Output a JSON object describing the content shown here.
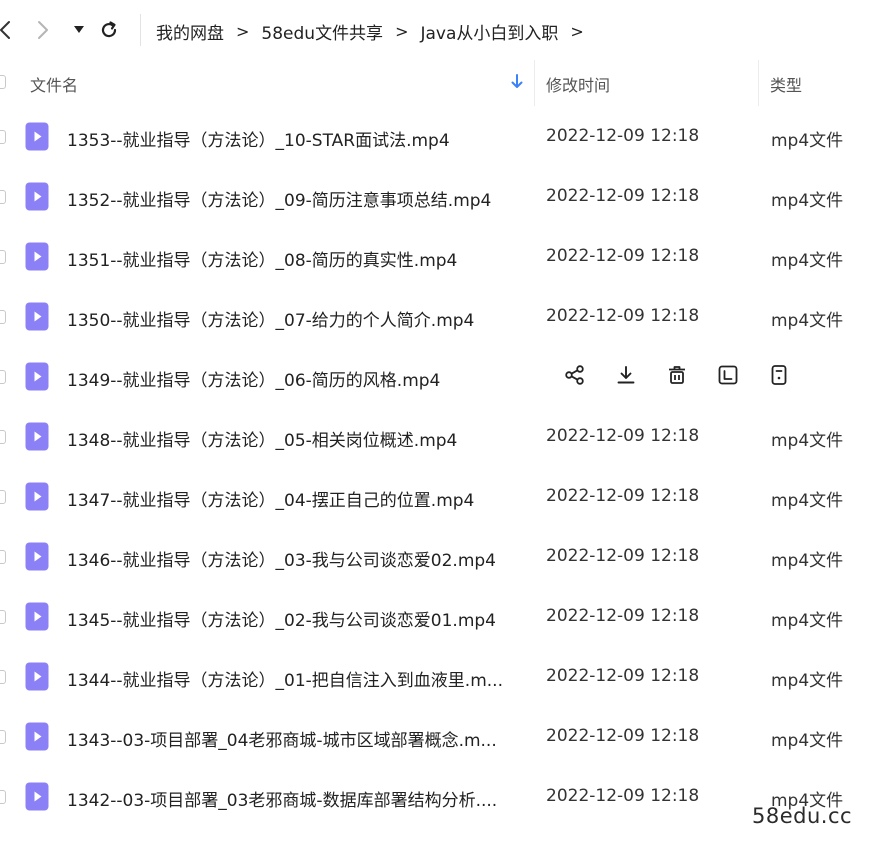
{
  "nav": {
    "breadcrumb": [
      "我的网盘",
      "58edu文件共享",
      "Java从小白到入职"
    ],
    "separator": ">"
  },
  "columns": {
    "name": "文件名",
    "modified": "修改时间",
    "type": "类型"
  },
  "colors": {
    "file_icon": "#8b80f5",
    "sort_arrow": "#3b82f6"
  },
  "files": [
    {
      "name": "1353--就业指导（方法论）_10-STAR面试法.mp4",
      "modified": "2022-12-09 12:18",
      "type": "mp4文件"
    },
    {
      "name": "1352--就业指导（方法论）_09-简历注意事项总结.mp4",
      "modified": "2022-12-09 12:18",
      "type": "mp4文件"
    },
    {
      "name": "1351--就业指导（方法论）_08-简历的真实性.mp4",
      "modified": "2022-12-09 12:18",
      "type": "mp4文件"
    },
    {
      "name": "1350--就业指导（方法论）_07-给力的个人简介.mp4",
      "modified": "2022-12-09 12:18",
      "type": "mp4文件"
    },
    {
      "name": "1349--就业指导（方法论）_06-简历的风格.mp4",
      "modified": "",
      "type": "",
      "hovered": true
    },
    {
      "name": "1348--就业指导（方法论）_05-相关岗位概述.mp4",
      "modified": "2022-12-09 12:18",
      "type": "mp4文件"
    },
    {
      "name": "1347--就业指导（方法论）_04-摆正自己的位置.mp4",
      "modified": "2022-12-09 12:18",
      "type": "mp4文件"
    },
    {
      "name": "1346--就业指导（方法论）_03-我与公司谈恋爱02.mp4",
      "modified": "2022-12-09 12:18",
      "type": "mp4文件"
    },
    {
      "name": "1345--就业指导（方法论）_02-我与公司谈恋爱01.mp4",
      "modified": "2022-12-09 12:18",
      "type": "mp4文件"
    },
    {
      "name": "1344--就业指导（方法论）_01-把自信注入到血液里.m...",
      "modified": "2022-12-09 12:18",
      "type": "mp4文件"
    },
    {
      "name": "1343--03-项目部署_04老邪商城-城市区域部署概念.m...",
      "modified": "2022-12-09 12:18",
      "type": "mp4文件"
    },
    {
      "name": "1342--03-项目部署_03老邪商城-数据库部署结构分析....",
      "modified": "2022-12-09 12:18",
      "type": "mp4文件"
    }
  ],
  "row_actions": [
    "share-icon",
    "download-icon",
    "delete-icon",
    "rename-icon",
    "more-icon"
  ],
  "watermark": "58edu.cc"
}
